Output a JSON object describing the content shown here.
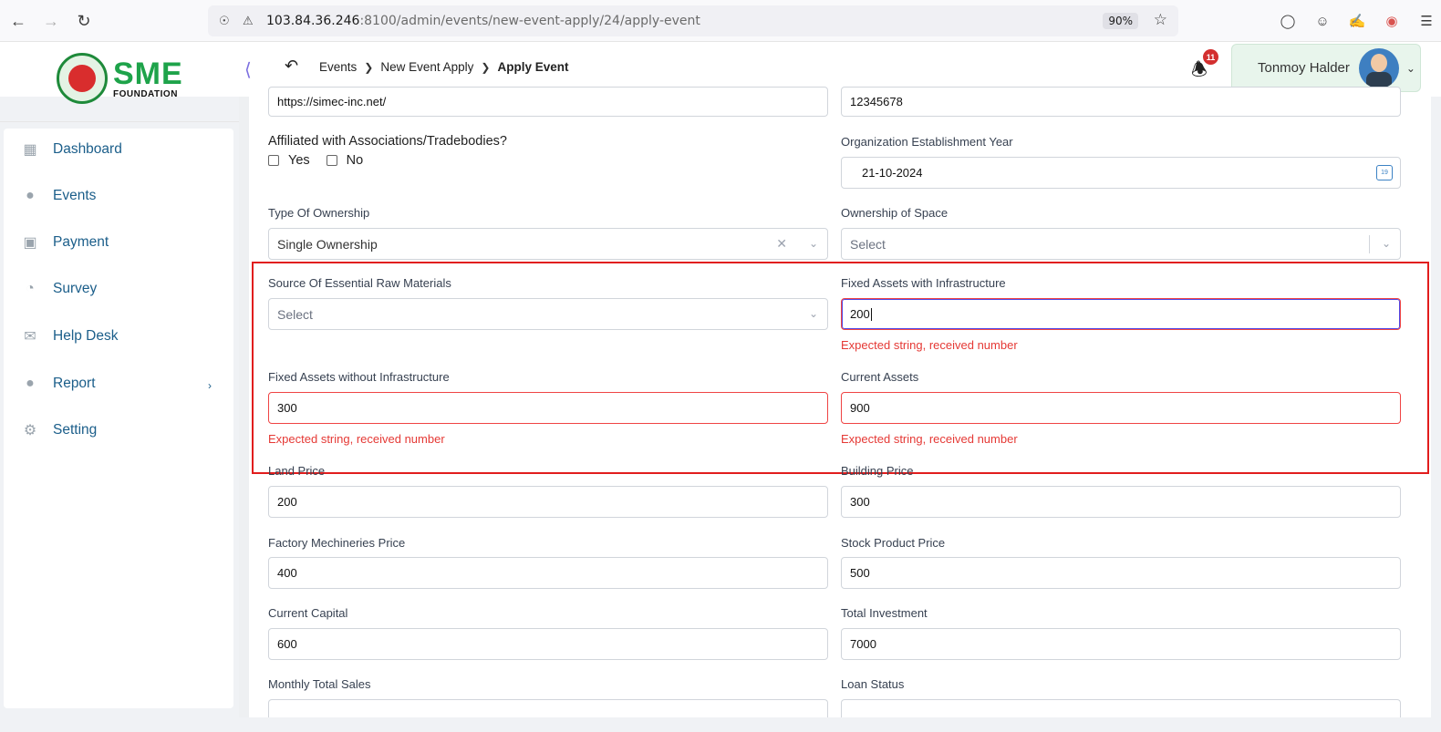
{
  "browser": {
    "url_host": "103.84.36.246",
    "url_path": ":8100/admin/events/new-event-apply/24/apply-event",
    "zoom": "90%"
  },
  "header": {
    "logo_sme": "SME",
    "logo_foundation": "FOUNDATION",
    "breadcrumb": [
      "Events",
      "New Event Apply",
      "Apply Event"
    ],
    "notification_count": "11",
    "user_name": "Tonmoy Halder"
  },
  "sidebar": {
    "items": [
      {
        "label": "Dashboard",
        "icon": "grid-icon"
      },
      {
        "label": "Events",
        "icon": "lock-icon"
      },
      {
        "label": "Payment",
        "icon": "cash-icon"
      },
      {
        "label": "Survey",
        "icon": "pie-icon"
      },
      {
        "label": "Help Desk",
        "icon": "mail-icon"
      },
      {
        "label": "Report",
        "icon": "lock-icon"
      },
      {
        "label": "Setting",
        "icon": "gear-icon"
      }
    ]
  },
  "form": {
    "website_value": "https://simec-inc.net/",
    "phone_value": "12345678",
    "affiliated_label": "Affiliated with Associations/Tradebodies?",
    "affiliated_yes": "Yes",
    "affiliated_no": "No",
    "establishment_label": "Organization Establishment Year",
    "establishment_value": "21-10-2024",
    "ownership_type_label": "Type Of Ownership",
    "ownership_type_value": "Single Ownership",
    "ownership_space_label": "Ownership of Space",
    "ownership_space_placeholder": "Select",
    "raw_materials_label": "Source Of Essential Raw Materials",
    "raw_materials_placeholder": "Select",
    "fixed_with_label": "Fixed Assets with Infrastructure",
    "fixed_with_value": "200",
    "fixed_with_error": "Expected string, received number",
    "fixed_without_label": "Fixed Assets without Infrastructure",
    "fixed_without_value": "300",
    "fixed_without_error": "Expected string, received number",
    "current_assets_label": "Current Assets",
    "current_assets_value": "900",
    "current_assets_error": "Expected string, received number",
    "land_price_label": "Land Price",
    "land_price_value": "200",
    "building_price_label": "Building Price",
    "building_price_value": "300",
    "factory_label": "Factory Mechineries Price",
    "factory_value": "400",
    "stock_label": "Stock Product Price",
    "stock_value": "500",
    "current_capital_label": "Current Capital",
    "current_capital_value": "600",
    "total_investment_label": "Total Investment",
    "total_investment_value": "7000",
    "monthly_sales_label": "Monthly Total Sales",
    "loan_status_label": "Loan Status"
  },
  "colors": {
    "error": "#e53935",
    "highlight": "#e11d1d",
    "accent": "#1ea34a"
  }
}
